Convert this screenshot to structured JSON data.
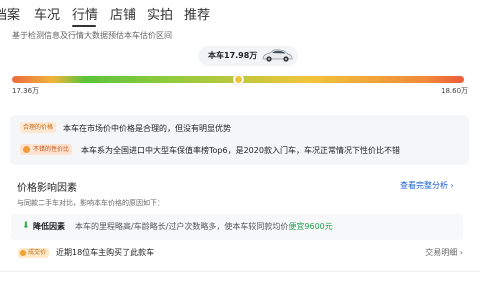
{
  "tabs": [
    "档案",
    "车况",
    "行情",
    "店铺",
    "实拍",
    "推荐"
  ],
  "header": {
    "subtitle": "基于检测信息及行情大数据预估本车估价区间"
  },
  "estimate": {
    "bubble_label": "本车17.98万",
    "min_label": "17.36万",
    "max_label": "18.60万",
    "position_fraction": 0.5
  },
  "info": {
    "reasonable_tag": "合理的价格",
    "reasonable_text": "本车在市场价中价格是合理的，但没有明显优势",
    "performance_tag": "不错的性价比",
    "performance_text": "本车系为全国进口中大型车保值率榜Top6，是2020款入门车，车况正常情况下性价比不错"
  },
  "factors": {
    "title": "价格影响因素",
    "link": "查看完整分析",
    "subtitle": "与同款二手车对比，影响本车价格的原因如下：",
    "item_title": "降低因素",
    "item_text_prefix": "本车的里程略高/车龄略长/过户次数略多，使本车较同款均价",
    "item_text_highlight": "便宜9600元"
  },
  "deal": {
    "tag": "成交价",
    "text": "近期18位车主购买了此款车",
    "link": "交易明细"
  },
  "colors": {
    "accent_blue": "#1a5fcf",
    "green": "#22a04a",
    "orange": "#c26a1a"
  }
}
